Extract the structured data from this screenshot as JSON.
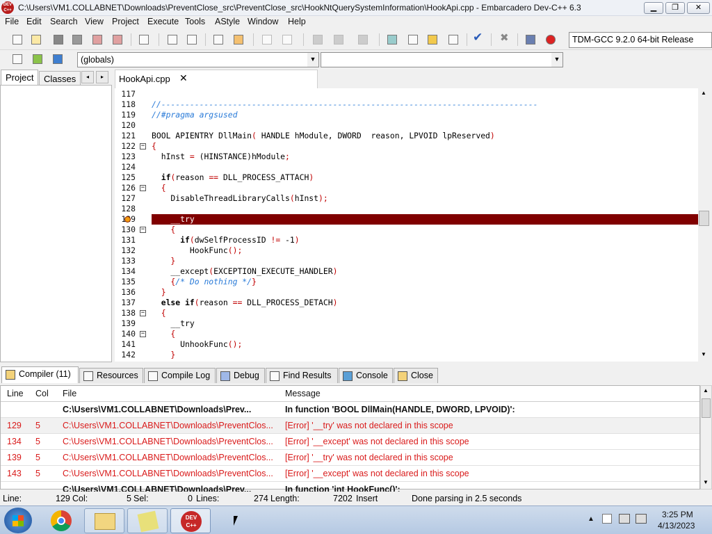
{
  "window": {
    "title": "C:\\Users\\VM1.COLLABNET\\Downloads\\PreventClose_src\\PreventClose_src\\HookNtQuerySystemInformation\\HookApi.cpp - Embarcadero Dev-C++ 6.3",
    "app_icon_text": "DEV C++",
    "minimize": "▁",
    "maximize": "❐",
    "close": "✕"
  },
  "menu": [
    "File",
    "Edit",
    "Search",
    "View",
    "Project",
    "Execute",
    "Tools",
    "AStyle",
    "Window",
    "Help"
  ],
  "toolbar": {
    "compiler_select": "TDM-GCC 9.2.0 64-bit Release",
    "scope_select": "(globals)",
    "symbol_select": ""
  },
  "left_panel": {
    "tabs": [
      "Project",
      "Classes"
    ],
    "scroll_left": "◂",
    "scroll_right": "▸"
  },
  "editor": {
    "tab_label": "HookApi.cpp",
    "tab_close": "✕",
    "lines": [
      {
        "n": "117",
        "segments": []
      },
      {
        "n": "118",
        "segments": [
          {
            "t": "//-------------------------------------------------------------------------------",
            "c": "cm"
          }
        ]
      },
      {
        "n": "119",
        "segments": [
          {
            "t": "//#pragma argsused",
            "c": "cm"
          }
        ]
      },
      {
        "n": "120",
        "segments": []
      },
      {
        "n": "121",
        "segments": [
          {
            "t": "BOOL APIENTRY DllMain",
            "c": ""
          },
          {
            "t": "(",
            "c": "sy"
          },
          {
            "t": " HANDLE hModule, DWORD  reason, LPVOID lpReserved",
            "c": ""
          },
          {
            "t": ")",
            "c": "sy"
          }
        ]
      },
      {
        "n": "122",
        "fold": "-",
        "segments": [
          {
            "t": "{",
            "c": "sy"
          }
        ]
      },
      {
        "n": "123",
        "segments": [
          {
            "t": "  hInst ",
            "c": ""
          },
          {
            "t": "=",
            "c": "sy"
          },
          {
            "t": " (HINSTANCE)hModule",
            "c": ""
          },
          {
            "t": ";",
            "c": "sy"
          }
        ]
      },
      {
        "n": "124",
        "segments": []
      },
      {
        "n": "125",
        "segments": [
          {
            "t": "  ",
            "c": ""
          },
          {
            "t": "if",
            "c": "kw"
          },
          {
            "t": "(",
            "c": "sy"
          },
          {
            "t": "reason ",
            "c": ""
          },
          {
            "t": "==",
            "c": "sy"
          },
          {
            "t": " DLL_PROCESS_ATTACH",
            "c": ""
          },
          {
            "t": ")",
            "c": "sy"
          }
        ]
      },
      {
        "n": "126",
        "fold": "-",
        "segments": [
          {
            "t": "  {",
            "c": "sy"
          }
        ]
      },
      {
        "n": "127",
        "segments": [
          {
            "t": "    DisableThreadLibraryCalls",
            "c": ""
          },
          {
            "t": "(",
            "c": "sy"
          },
          {
            "t": "hInst",
            "c": ""
          },
          {
            "t": ");",
            "c": "sy"
          }
        ]
      },
      {
        "n": "128",
        "segments": []
      },
      {
        "n": "129",
        "hl": true,
        "bp": true,
        "segments": [
          {
            "t": "    __try",
            "c": ""
          }
        ]
      },
      {
        "n": "130",
        "fold": "-",
        "segments": [
          {
            "t": "    {",
            "c": "sy"
          }
        ]
      },
      {
        "n": "131",
        "segments": [
          {
            "t": "      ",
            "c": ""
          },
          {
            "t": "if",
            "c": "kw"
          },
          {
            "t": "(",
            "c": "sy"
          },
          {
            "t": "dwSelfProcessID ",
            "c": ""
          },
          {
            "t": "!=",
            "c": "sy"
          },
          {
            "t": " -1",
            "c": ""
          },
          {
            "t": ")",
            "c": "sy"
          }
        ]
      },
      {
        "n": "132",
        "segments": [
          {
            "t": "        HookFunc",
            "c": ""
          },
          {
            "t": "();",
            "c": "sy"
          }
        ]
      },
      {
        "n": "133",
        "segments": [
          {
            "t": "    }",
            "c": "sy"
          }
        ]
      },
      {
        "n": "134",
        "segments": [
          {
            "t": "    __except",
            "c": ""
          },
          {
            "t": "(",
            "c": "sy"
          },
          {
            "t": "EXCEPTION_EXECUTE_HANDLER",
            "c": ""
          },
          {
            "t": ")",
            "c": "sy"
          }
        ]
      },
      {
        "n": "135",
        "segments": [
          {
            "t": "    {",
            "c": "sy"
          },
          {
            "t": "/* Do nothing */",
            "c": "cm"
          },
          {
            "t": "}",
            "c": "sy"
          }
        ]
      },
      {
        "n": "136",
        "segments": [
          {
            "t": "  }",
            "c": "sy"
          }
        ]
      },
      {
        "n": "137",
        "segments": [
          {
            "t": "  ",
            "c": ""
          },
          {
            "t": "else if",
            "c": "kw"
          },
          {
            "t": "(",
            "c": "sy"
          },
          {
            "t": "reason ",
            "c": ""
          },
          {
            "t": "==",
            "c": "sy"
          },
          {
            "t": " DLL_PROCESS_DETACH",
            "c": ""
          },
          {
            "t": ")",
            "c": "sy"
          }
        ]
      },
      {
        "n": "138",
        "fold": "-",
        "segments": [
          {
            "t": "  {",
            "c": "sy"
          }
        ]
      },
      {
        "n": "139",
        "segments": [
          {
            "t": "    __try",
            "c": ""
          }
        ]
      },
      {
        "n": "140",
        "fold": "-",
        "segments": [
          {
            "t": "    {",
            "c": "sy"
          }
        ]
      },
      {
        "n": "141",
        "segments": [
          {
            "t": "      UnhookFunc",
            "c": ""
          },
          {
            "t": "();",
            "c": "sy"
          }
        ]
      },
      {
        "n": "142",
        "segments": [
          {
            "t": "    }",
            "c": "sy"
          }
        ]
      }
    ]
  },
  "bottom_tabs": [
    "Compiler (11)",
    "Resources",
    "Compile Log",
    "Debug",
    "Find Results",
    "Console",
    "Close"
  ],
  "messages": {
    "headers": {
      "line": "Line",
      "col": "Col",
      "file": "File",
      "message": "Message"
    },
    "rows": [
      {
        "line": "",
        "col": "",
        "file": "C:\\Users\\VM1.COLLABNET\\Downloads\\Prev...",
        "message": "In function 'BOOL DllMain(HANDLE, DWORD, LPVOID)':",
        "style": "bold"
      },
      {
        "line": "129",
        "col": "5",
        "file": "C:\\Users\\VM1.COLLABNET\\Downloads\\PreventClos...",
        "message": "[Error] '__try' was not declared in this scope",
        "style": "err"
      },
      {
        "line": "134",
        "col": "5",
        "file": "C:\\Users\\VM1.COLLABNET\\Downloads\\PreventClos...",
        "message": "[Error] '__except' was not declared in this scope",
        "style": "err"
      },
      {
        "line": "139",
        "col": "5",
        "file": "C:\\Users\\VM1.COLLABNET\\Downloads\\PreventClos...",
        "message": "[Error] '__try' was not declared in this scope",
        "style": "err"
      },
      {
        "line": "143",
        "col": "5",
        "file": "C:\\Users\\VM1.COLLABNET\\Downloads\\PreventClos...",
        "message": "[Error] '__except' was not declared in this scope",
        "style": "err"
      },
      {
        "line": "",
        "col": "",
        "file": "C:\\Users\\VM1.COLLABNET\\Downloads\\Prev...",
        "message": "In function 'int HookFunc()':",
        "style": "bold"
      }
    ]
  },
  "status": {
    "line_label": "Line:",
    "line_val": "129",
    "col_label": "Col:",
    "col_val": "5",
    "sel_label": "Sel:",
    "sel_val": "0",
    "lines_label": "Lines:",
    "lines_val": "274",
    "length_label": "Length:",
    "length_val": "7202",
    "mode": "Insert",
    "message": "Done parsing in 2.5 seconds"
  },
  "taskbar": {
    "time": "3:25 PM",
    "date": "4/13/2023",
    "devcpp_label": "DEV C++"
  }
}
